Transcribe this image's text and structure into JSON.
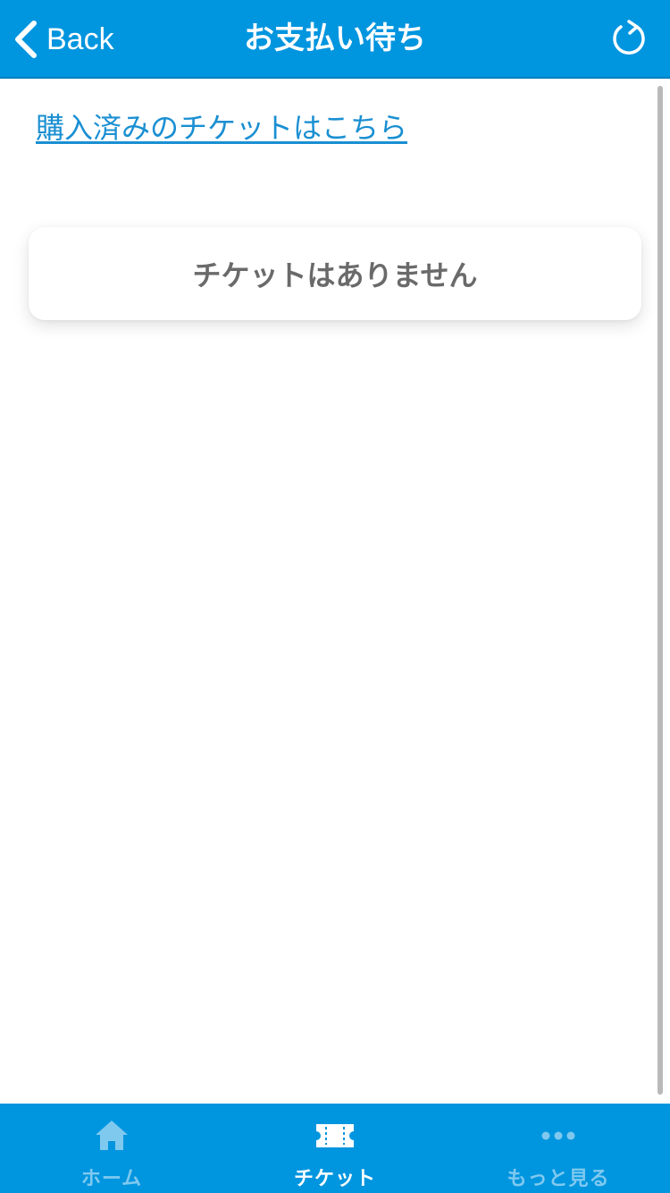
{
  "header": {
    "back_label": "Back",
    "title": "お支払い待ち",
    "icons": {
      "back": "chevron-left-icon",
      "refresh": "refresh-icon"
    }
  },
  "content": {
    "purchased_link": "購入済みのチケットはこちら",
    "empty_message": "チケットはありません"
  },
  "tabbar": {
    "items": [
      {
        "label": "ホーム",
        "icon": "home-icon",
        "active": false
      },
      {
        "label": "チケット",
        "icon": "ticket-icon",
        "active": true
      },
      {
        "label": "もっと見る",
        "icon": "more-dots-icon",
        "active": false
      }
    ]
  },
  "colors": {
    "brand": "#0095df",
    "link": "#1a8fd2",
    "inactive_tab": "#7fc9ef",
    "empty_text": "#6a6a6a"
  }
}
